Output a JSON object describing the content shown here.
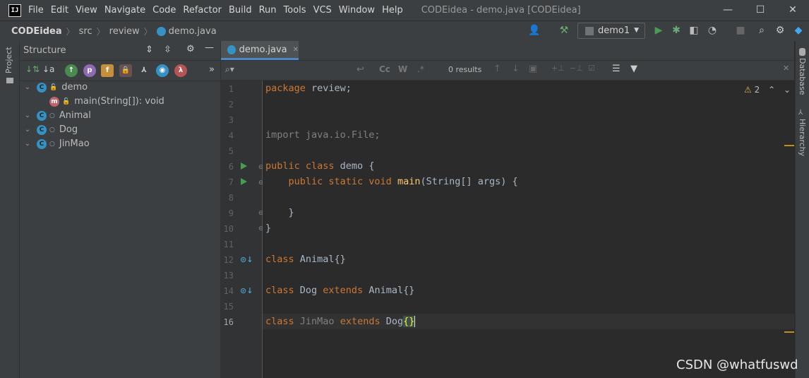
{
  "titlebar": {
    "logo": "IJ",
    "menu": [
      "File",
      "Edit",
      "View",
      "Navigate",
      "Code",
      "Refactor",
      "Build",
      "Run",
      "Tools",
      "VCS",
      "Window",
      "Help"
    ],
    "window_title": "CODEidea - demo.java [CODEidea]",
    "minimize": "—",
    "maximize": "☐",
    "close": "✕"
  },
  "navbar": {
    "breadcrumbs": [
      "CODEidea",
      "src",
      "review",
      "demo.java"
    ],
    "run_config": "demo1"
  },
  "left_stripe": {
    "project_label": "Project"
  },
  "structure": {
    "title": "Structure",
    "tree": [
      {
        "label": "demo",
        "expanded": true
      },
      {
        "label": "main(String[]): void"
      },
      {
        "label": "Animal"
      },
      {
        "label": "Dog"
      },
      {
        "label": "JinMao"
      }
    ]
  },
  "editor": {
    "tab_label": "demo.java",
    "search": {
      "results": "0 results",
      "case_label": "Cc",
      "word_label": "W",
      "regex_label": ".*"
    },
    "warnings_count": "2",
    "line_numbers": [
      "1",
      "2",
      "3",
      "4",
      "5",
      "6",
      "7",
      "8",
      "9",
      "10",
      "11",
      "12",
      "13",
      "14",
      "15",
      "16"
    ]
  },
  "right_stripe": {
    "database_label": "Database",
    "hierarchy_label": "Hierarchy"
  },
  "watermark": "CSDN @whatfuswd",
  "colors": {
    "background": "#2b2b2b",
    "panel": "#3c3f41",
    "keyword": "#cc7832",
    "function": "#ffc66d",
    "text": "#a9b7c6",
    "accent": "#4a88c7",
    "run_green": "#499c54"
  }
}
